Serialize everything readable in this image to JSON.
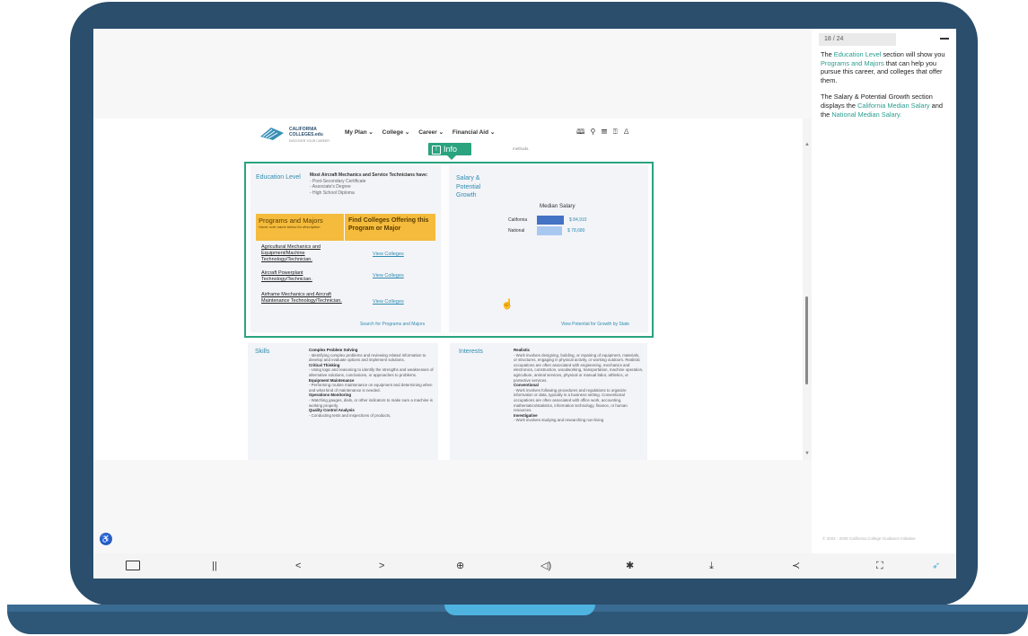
{
  "side_panel": {
    "progress": "18 / 24",
    "para1": [
      {
        "t": "The ",
        "hl": false
      },
      {
        "t": "Education Level",
        "hl": true
      },
      {
        "t": " section will show you ",
        "hl": false
      },
      {
        "t": "Programs and Majors",
        "hl": true
      },
      {
        "t": " that can help you pursue this career, and colleges that offer them.",
        "hl": false
      }
    ],
    "para2": [
      {
        "t": "The Salary & Potential Growth section displays the ",
        "hl": false
      },
      {
        "t": "California Median Salary",
        "hl": true
      },
      {
        "t": " and the ",
        "hl": false
      },
      {
        "t": "National Median Salary.",
        "hl": true
      }
    ],
    "footer": "© 2022 - 2025 California College Guidance Initiative",
    "colors": {
      "highlight": "#2a9d8f",
      "frame": "#2a4e6c"
    }
  },
  "site": {
    "logo": {
      "line1": "CALIFORNIA",
      "line2": "COLLEGES.edu",
      "tagline": "DISCOVER YOUR CAREER"
    },
    "nav": [
      "My Plan ⌄",
      "College ⌄",
      "Career ⌄",
      "Financial Aid ⌄"
    ],
    "nav_icons": [
      "book-icon",
      "search-icon",
      "list-icon",
      "help-icon",
      "user-icon"
    ],
    "methods_text": "methods."
  },
  "info_badge": {
    "label": "Info",
    "icon": "info-icon",
    "color": "#2aa37f"
  },
  "education": {
    "title": "Education Level",
    "intro": "Most Aircraft Mechanics and Service Technicians have:",
    "levels": [
      "- Post-Secondary Certificate",
      "- Associate's Degree",
      "- High School Diploma"
    ],
    "programs_header": "Programs and Majors",
    "programs_hint": "Hover over name below for description",
    "colleges_header": "Find Colleges Offering this Program or Major",
    "programs": [
      {
        "name": "Agricultural Mechanics and Equipment/Machine Technology/Technician.",
        "link": "View Colleges"
      },
      {
        "name": "Aircraft Powerplant Technology/Technician.",
        "link": "View Colleges"
      },
      {
        "name": "Airframe Mechanics and Aircraft Maintenance Technology/Technician.",
        "link": "View Colleges"
      }
    ],
    "search_link": "Search for Programs and Majors"
  },
  "salary": {
    "title": "Salary & Potential Growth",
    "chart_title": "Median Salary",
    "growth_link": "View Potential for Growth by State"
  },
  "chart_data": {
    "type": "bar",
    "title": "Median Salary",
    "categories": [
      "California",
      "National"
    ],
    "values": [
      84910,
      78680
    ],
    "value_labels": [
      "$ 84,910",
      "$ 78,680"
    ],
    "colors": [
      "#4472c4",
      "#a9c8f0"
    ],
    "orientation": "horizontal",
    "xlabel": "",
    "ylabel": ""
  },
  "skills": {
    "title": "Skills",
    "items": [
      {
        "name": "Complex Problem Solving",
        "desc": "- Identifying complex problems and reviewing related information to develop and evaluate options and implement solutions."
      },
      {
        "name": "Critical Thinking",
        "desc": "- Using logic and reasoning to identify the strengths and weaknesses of alternative solutions, conclusions, or approaches to problems."
      },
      {
        "name": "Equipment Maintenance",
        "desc": "- Performing routine maintenance on equipment and determining when and what kind of maintenance is needed."
      },
      {
        "name": "Operations Monitoring",
        "desc": "- Watching gauges, dials, or other indicators to make sure a machine is working properly."
      },
      {
        "name": "Quality Control Analysis",
        "desc": "- Conducting tests and inspections of products,"
      }
    ]
  },
  "interests": {
    "title": "Interests",
    "items": [
      {
        "name": "Realistic",
        "desc": "- Work involves designing, building, or repairing of equipment, materials, or structures, engaging in physical activity, or working outdoors. Realistic occupations are often associated with engineering, mechanics and electronics, construction, woodworking, transportation, machine operation, agriculture, animal services, physical or manual labor, athletics, or protective services."
      },
      {
        "name": "Conventional",
        "desc": "- Work involves following procedures and regulations to organize information or data, typically in a business setting. Conventional occupations are often associated with office work, accounting, mathematics/statistics, information technology, finance, or human resources."
      },
      {
        "name": "Investigative",
        "desc": "- Work involves studying and researching non-living"
      }
    ]
  },
  "controls": [
    {
      "name": "captions-button",
      "glyph": ""
    },
    {
      "name": "pause-button",
      "glyph": "||"
    },
    {
      "name": "previous-button",
      "glyph": "<"
    },
    {
      "name": "next-button",
      "glyph": ">"
    },
    {
      "name": "zoom-button",
      "glyph": "⊕"
    },
    {
      "name": "volume-button",
      "glyph": "◁)"
    },
    {
      "name": "settings-button",
      "glyph": "✱"
    },
    {
      "name": "download-button",
      "glyph": "⤓"
    },
    {
      "name": "share-button",
      "glyph": "≺"
    },
    {
      "name": "fullscreen-button",
      "glyph": "⛶"
    },
    {
      "name": "brand-logo",
      "glyph": "➶"
    }
  ]
}
